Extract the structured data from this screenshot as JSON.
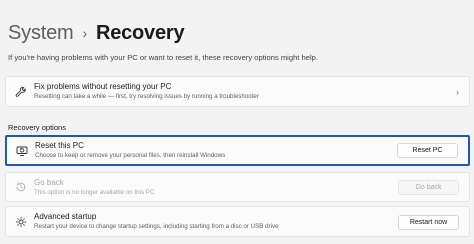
{
  "breadcrumb": {
    "parent": "System",
    "separator": "›",
    "current": "Recovery"
  },
  "intro_text": "If you're having problems with your PC or want to reset it, these recovery options might help.",
  "fix_problems": {
    "icon": "wrench-icon",
    "title": "Fix problems without resetting your PC",
    "description": "Resetting can take a while — first, try resolving issues by running a troubleshooter",
    "chevron": "›"
  },
  "section_title": "Recovery options",
  "reset_pc": {
    "icon": "reset-pc-icon",
    "title": "Reset this PC",
    "description": "Choose to keep or remove your personal files, then reinstall Windows",
    "button": "Reset PC",
    "highlighted": true,
    "highlight_color": "#1e5bab"
  },
  "go_back": {
    "icon": "history-icon",
    "title": "Go back",
    "description": "This option is no longer available on this PC",
    "button": "Go back",
    "disabled": true
  },
  "advanced_startup": {
    "icon": "advanced-startup-icon",
    "title": "Advanced startup",
    "description": "Restart your device to change startup settings, including starting from a disc or USB drive",
    "button": "Restart now"
  }
}
